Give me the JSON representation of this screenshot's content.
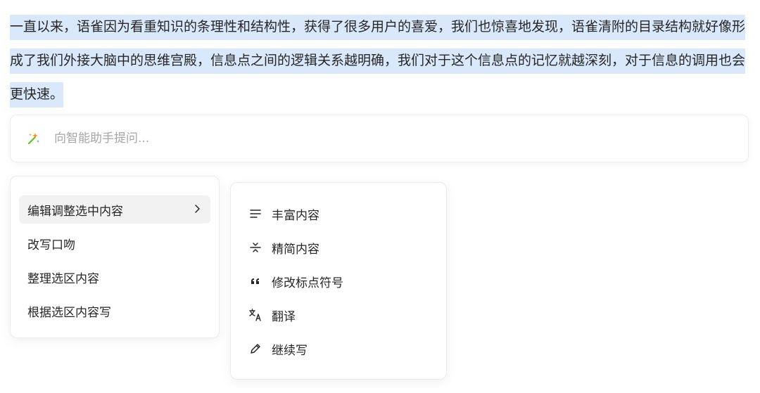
{
  "document": {
    "paragraph": "一直以来，语雀因为看重知识的条理性和结构性，获得了很多用户的喜爱，我们也惊喜地发现，语雀清附的目录结构就好像形成了我们外接大脑中的思维宫殿，信息点之间的逻辑关系越明确，我们对于这个信息点的记忆就越深刻，对于信息的调用也会更快速。"
  },
  "ai_assistant": {
    "placeholder": "向智能助手提问...",
    "icon": "magic-wand-icon"
  },
  "menu": {
    "items": [
      {
        "label": "编辑调整选中内容",
        "has_submenu": true,
        "active": true
      },
      {
        "label": "改写口吻"
      },
      {
        "label": "整理选区内容"
      },
      {
        "label": "根据选区内容写"
      }
    ]
  },
  "submenu": {
    "items": [
      {
        "label": "丰富内容",
        "icon": "align-lines-icon"
      },
      {
        "label": "精简内容",
        "icon": "compress-icon"
      },
      {
        "label": "修改标点符号",
        "icon": "quote-icon"
      },
      {
        "label": "翻译",
        "icon": "translate-icon"
      },
      {
        "label": "继续写",
        "icon": "pencil-icon"
      }
    ]
  },
  "colors": {
    "selection": "#d9e8fb",
    "active_item": "#f2f2f2",
    "spark_green": "#52c41a",
    "spark_orange": "#fa8c16"
  }
}
